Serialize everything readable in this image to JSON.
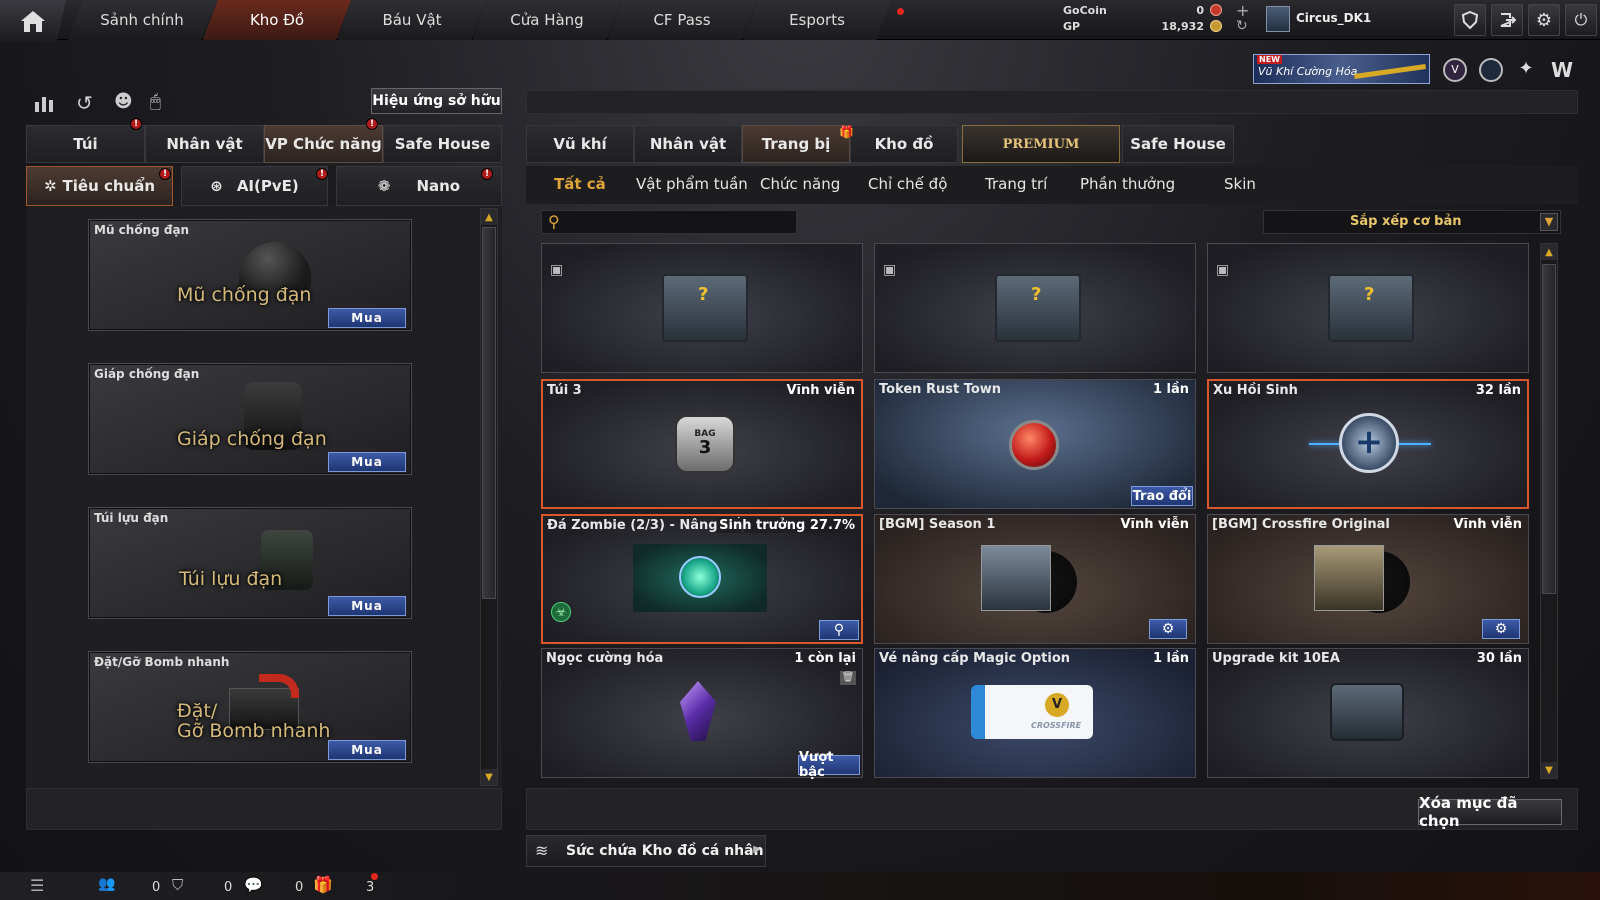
{
  "topnav": {
    "tabs": [
      "Sảnh chính",
      "Kho Đồ",
      "Báu Vật",
      "Cửa Hàng",
      "CF Pass",
      "Esports"
    ],
    "active_index": 1
  },
  "currency": {
    "gocoin_label": "GoCoin",
    "gocoin_value": "0",
    "gp_label": "GP",
    "gp_value": "18,932"
  },
  "user": {
    "name": "Circus_DK1"
  },
  "banner": {
    "new_label": "NEW",
    "text": "Vũ Khí Cường Hóa"
  },
  "left": {
    "effects_button": "Hiệu ứng sở hữu",
    "tabs": [
      "Túi",
      "Nhân vật",
      "VP Chức năng",
      "Safe House"
    ],
    "active_tab": 2,
    "subtabs": [
      "Tiêu chuẩn",
      "AI(PvE)",
      "Nano"
    ],
    "items": [
      {
        "title": "Mũ chống đạn",
        "overlay": "Mũ chống đạn",
        "buy": "Mua"
      },
      {
        "title": "Giáp chống đạn",
        "overlay": "Giáp chống đạn",
        "buy": "Mua"
      },
      {
        "title": "Túi lựu đạn",
        "overlay": "Túi lựu đạn",
        "buy": "Mua"
      },
      {
        "title": "Đặt/Gỡ Bomb nhanh",
        "overlay_line1": "Đặt/",
        "overlay_line2": "Gỡ Bomb nhanh",
        "buy": "Mua"
      }
    ]
  },
  "right": {
    "tabs": [
      "Vũ khí",
      "Nhân vật",
      "Trang bị",
      "Kho đồ",
      "PREMIUM",
      "Safe House"
    ],
    "active_tab": 2,
    "filters": [
      "Tất cả",
      "Vật phẩm tuần",
      "Chức năng",
      "Chỉ chế độ",
      "Trang trí",
      "Phần thưởng",
      "Skin"
    ],
    "active_filter": 0,
    "search_placeholder": "",
    "sort_label": "Sắp xếp cơ bản",
    "items": [
      {
        "name": "",
        "duration": ""
      },
      {
        "name": "",
        "duration": ""
      },
      {
        "name": "",
        "duration": ""
      },
      {
        "name": "Túi 3",
        "duration": "Vĩnh viễn"
      },
      {
        "name": "Token Rust Town",
        "duration": "1 lần",
        "action": "Trao đổi"
      },
      {
        "name": "Xu Hồi Sinh",
        "duration": "32 lần"
      },
      {
        "name": "Đá Zombie (2/3) - Nâng Cấp",
        "duration": "Sinh trưởng 27.7%"
      },
      {
        "name": "[BGM] Season 1",
        "duration": "Vĩnh viễn"
      },
      {
        "name": "[BGM] Crossfire Original",
        "duration": "Vĩnh viễn"
      },
      {
        "name": "Ngọc cường hóa",
        "duration": "1 còn lại",
        "action": "Vượt bậc"
      },
      {
        "name": "Vé nâng cấp Magic Option",
        "duration": "1 lần"
      },
      {
        "name": "Upgrade kit 10EA",
        "duration": "30 lần"
      }
    ],
    "bag3_label": "BAG",
    "bag3_num": "3",
    "ticket_text": "CROSSFIRE",
    "delete_button": "Xóa mục đã chọn",
    "capacity_label": "Sức chứa Kho đồ cá nhân"
  },
  "bottombar": {
    "count1": "0",
    "count2": "0",
    "count3": "0",
    "gift_count": "3"
  },
  "colors": {
    "accent_orange": "#d8572b",
    "blue_button": "#2b4690",
    "gold": "#d8a924"
  }
}
